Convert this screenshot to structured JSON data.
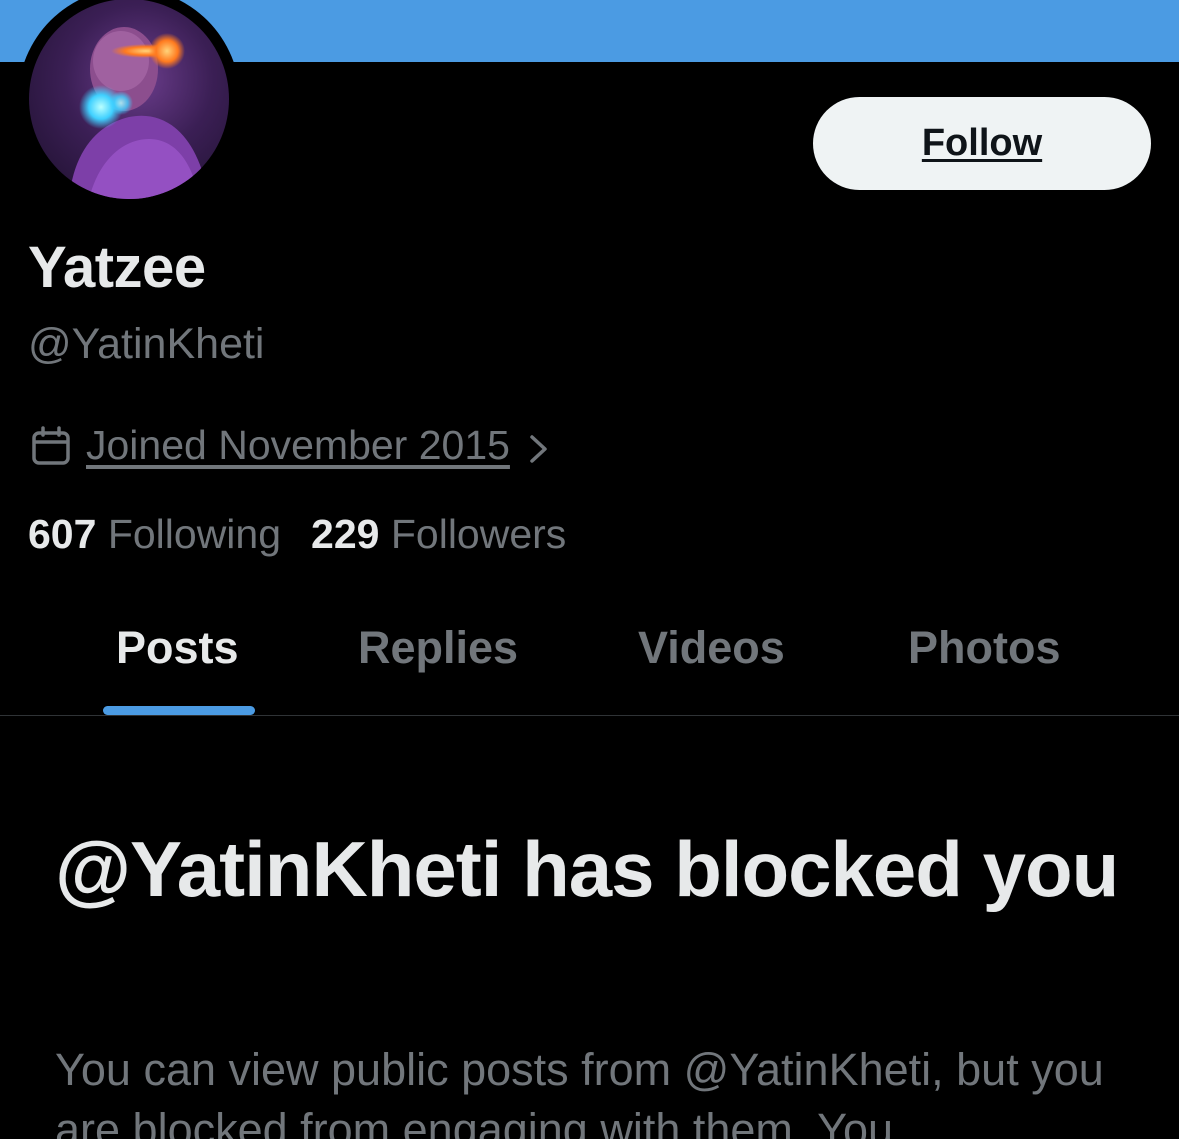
{
  "profile": {
    "display_name": "Yatzee",
    "handle": "@YatinKheti",
    "joined": "Joined November 2015",
    "following_count": "607",
    "following_label": "Following",
    "followers_count": "229",
    "followers_label": "Followers"
  },
  "actions": {
    "follow_label": "Follow"
  },
  "tabs": [
    {
      "label": "Posts",
      "active": true
    },
    {
      "label": "Replies",
      "active": false
    },
    {
      "label": "Videos",
      "active": false
    },
    {
      "label": "Photos",
      "active": false
    }
  ],
  "blocked": {
    "title": "@YatinKheti has blocked you",
    "description": "You can view public posts from @YatinKheti, but you are blocked from engaging with them. You"
  },
  "colors": {
    "banner": "#4b9be3",
    "background": "#000000",
    "accent": "#4b9be3",
    "muted_text": "#71767b",
    "primary_text": "#e7e9ea"
  },
  "icons": {
    "calendar": "calendar-icon",
    "chevron": "chevron-right-icon"
  }
}
